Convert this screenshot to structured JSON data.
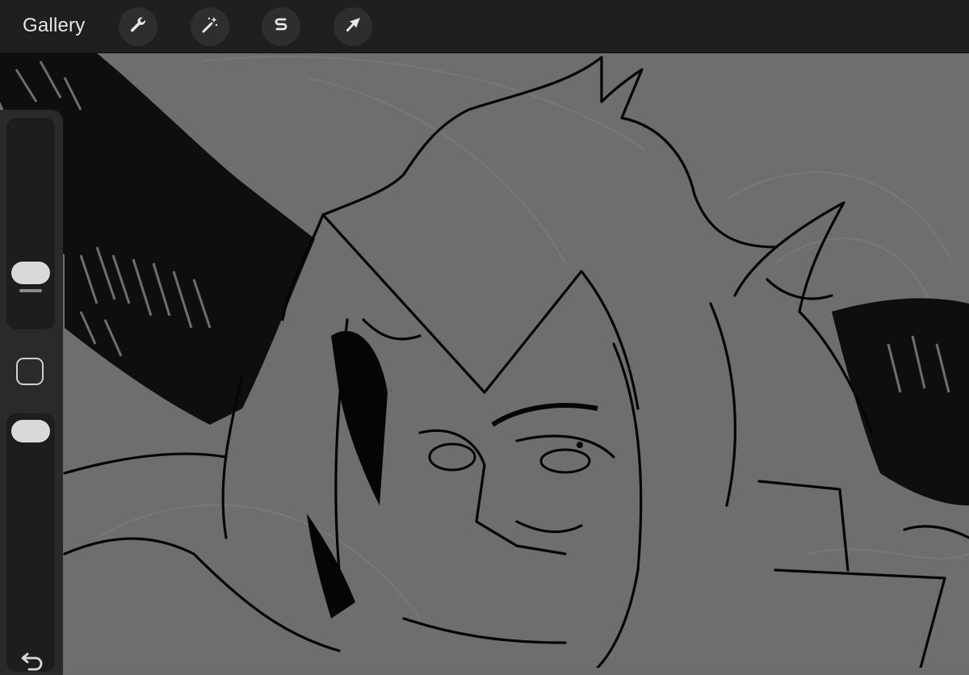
{
  "toolbar": {
    "gallery_label": "Gallery",
    "tools": [
      {
        "name": "actions",
        "icon": "wrench-icon"
      },
      {
        "name": "adjustments",
        "icon": "magic-wand-icon"
      },
      {
        "name": "selection",
        "icon": "selection-s-icon"
      },
      {
        "name": "transform",
        "icon": "arrow-cursor-icon"
      }
    ]
  },
  "sidebar": {
    "brush_size_icon": "brush-size-slider",
    "modify_icon": "modify-square-icon",
    "opacity_icon": "opacity-slider",
    "undo_icon": "undo-arrow-icon"
  },
  "colors": {
    "toolbar_bg": "#1f1f1f",
    "canvas_bg": "#6e6e6e",
    "ink": "#050505",
    "sidebar_bg": "#2a2a2a"
  }
}
